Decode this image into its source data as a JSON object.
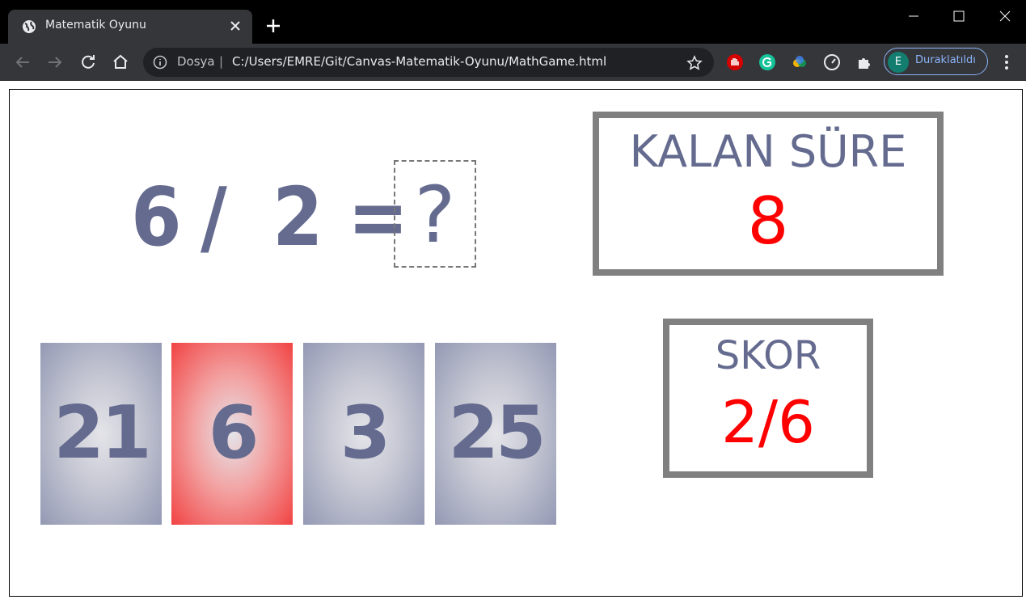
{
  "browser": {
    "tab_title": "Matematik Oyunu",
    "secure_label": "Dosya",
    "separator": "|",
    "url": "C:/Users/EMRE/Git/Canvas-Matematik-Oyunu/MathGame.html",
    "profile_initial": "E",
    "profile_label": "Duraklatıldı",
    "colors": {
      "chrome_bg": "#35363a",
      "titlebar_bg": "#000000",
      "accent": "#8ab4f8"
    }
  },
  "game": {
    "equation": {
      "operand_a": "6",
      "operator": "/",
      "operand_b": "2",
      "equals": "=",
      "answer": "?"
    },
    "options": [
      {
        "value": "21",
        "highlighted": false
      },
      {
        "value": "6",
        "highlighted": true
      },
      {
        "value": "3",
        "highlighted": false
      },
      {
        "value": "25",
        "highlighted": false
      }
    ],
    "timer": {
      "label": "KALAN SÜRE",
      "value": "8"
    },
    "score": {
      "label": "SKOR",
      "value": "2/6"
    },
    "colors": {
      "text": "#656b8f",
      "highlight": "#ff0000",
      "panel_border": "#808080"
    }
  }
}
